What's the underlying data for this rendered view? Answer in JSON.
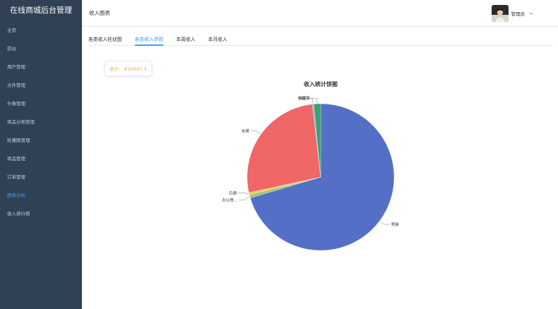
{
  "app": {
    "title": "在线商城后台管理",
    "page_title": "收入图表",
    "user": {
      "name": "管理员"
    }
  },
  "sidebar": {
    "items": [
      {
        "label": "主页"
      },
      {
        "label": "前台"
      },
      {
        "label": "用户管理"
      },
      {
        "label": "文件管理"
      },
      {
        "label": "头像管理"
      },
      {
        "label": "商品分类管理"
      },
      {
        "label": "轮播图管理"
      },
      {
        "label": "商品管理"
      },
      {
        "label": "订单管理"
      },
      {
        "label": "图表分析",
        "active": true
      },
      {
        "label": "收入排行榜"
      }
    ]
  },
  "tabs": [
    {
      "label": "各类收入柱状图"
    },
    {
      "label": "各类收入饼图",
      "active": true
    },
    {
      "label": "本周收入"
    },
    {
      "label": "本月收入"
    }
  ],
  "summary": {
    "total_text": "总计：￥20007.5"
  },
  "colors": {
    "sidebar_bg": "#304156",
    "accent": "#409eff",
    "total_text": "#e6a23c"
  },
  "chart_data": {
    "type": "pie",
    "title": "收入统计饼图",
    "slices": [
      {
        "name": "男装",
        "value": 70.4,
        "color": "#5470c6"
      },
      {
        "name": "办公用...",
        "value": 0.7,
        "color": "#91cc75"
      },
      {
        "name": "白酒",
        "value": 0.5,
        "color": "#fac858"
      },
      {
        "name": "女装",
        "value": 26.6,
        "color": "#ee6666"
      },
      {
        "name": "书籍",
        "value": 0.3,
        "color": "#73c0de"
      },
      {
        "name": "休闲服",
        "value": 1.5,
        "color": "#3ba272"
      }
    ]
  }
}
